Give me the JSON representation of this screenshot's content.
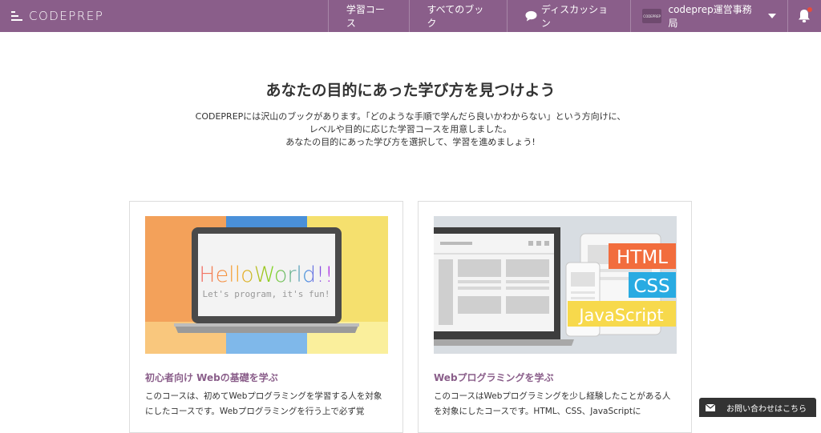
{
  "header": {
    "logo_text": "CODEPREP",
    "nav": [
      "学習コース",
      "すべてのブック",
      "ディスカッション"
    ],
    "user_name": "codeprep運営事務局",
    "avatar_text": "CODEPREP"
  },
  "intro": {
    "title": "あなたの目的にあった学び方を見つけよう",
    "lines": [
      "CODEPREPには沢山のブックがあります。「どのような手順で学んだら良いかわからない」という方向けに、",
      "レベルや目的に応じた学習コースを用意しました。",
      "あなたの目的にあった学び方を選択して、学習を進めましょう!"
    ]
  },
  "cards": [
    {
      "image_title": "HelloWorld!!",
      "image_subtitle": "Let's program, it's fun!",
      "title": "初心者向け Webの基礎を学ぶ",
      "text": "このコースは、初めてWebプログラミングを学習する人を対象にしたコースです。Webプログラミングを行う上で必ず覚"
    },
    {
      "tags": [
        "HTML",
        "CSS",
        "JavaScript"
      ],
      "title": "Webプログラミングを学ぶ",
      "text": "このコースはWebプログラミングを少し経験したことがある人を対象にしたコースです。HTML、CSS、JavaScriptに"
    }
  ],
  "contact_label": "お問い合わせはこちら",
  "colors": {
    "header": "#8a5e8a",
    "accent": "#8a5e8a",
    "html_tag": "#f26d3d",
    "css_tag": "#29abe2",
    "js_tag": "#f7d94c"
  }
}
